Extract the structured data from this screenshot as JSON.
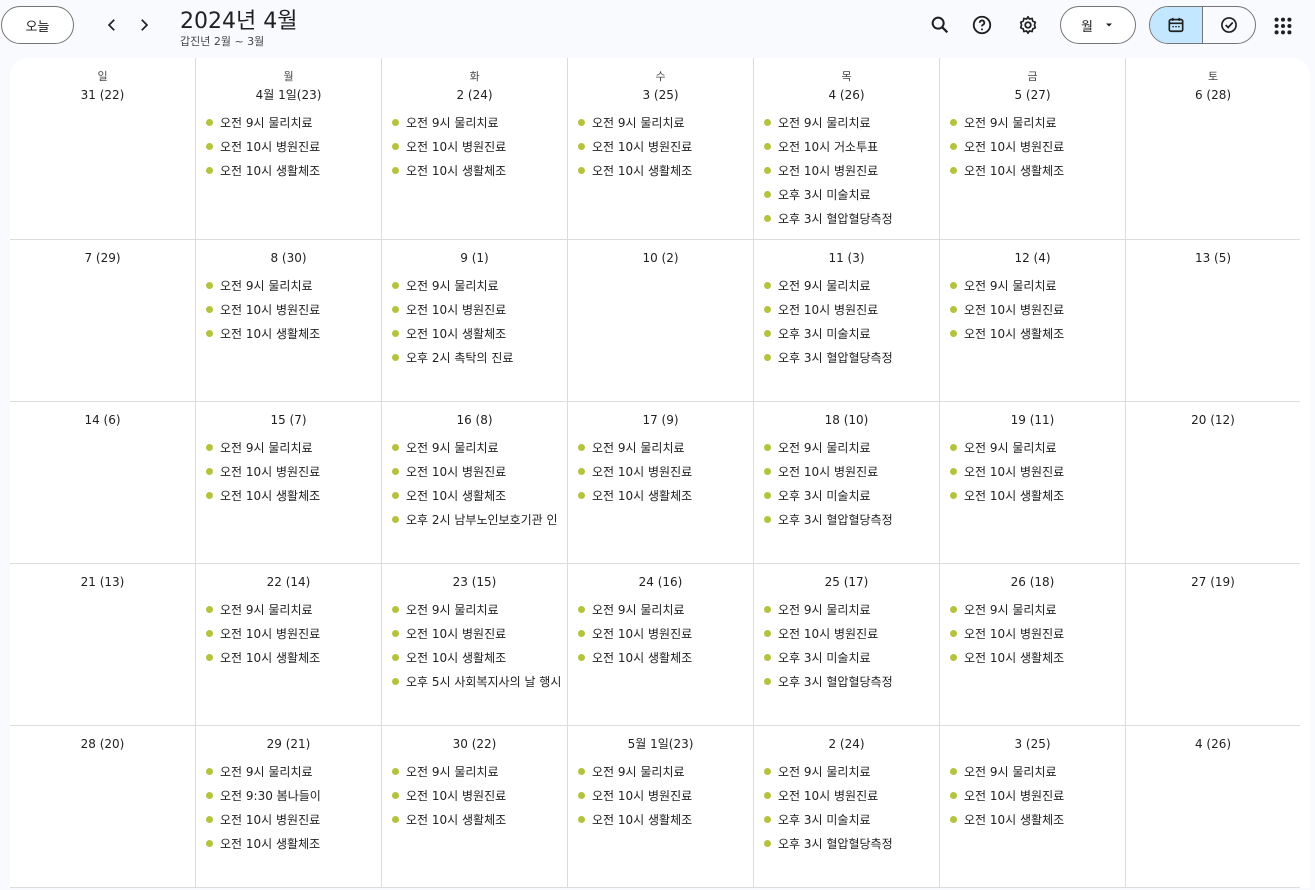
{
  "header": {
    "today_label": "오늘",
    "title": "2024년 4월",
    "subtitle": "갑진년 2월 ~ 3월",
    "view_label": "월",
    "icons": [
      "search-icon",
      "help-icon",
      "settings-icon",
      "calendar-icon",
      "tasks-icon",
      "apps-icon"
    ]
  },
  "colors": {
    "event_dot": "#b4c23c",
    "toggle_active": "#c2e7ff"
  },
  "weekdays": [
    "일",
    "월",
    "화",
    "수",
    "목",
    "금",
    "토"
  ],
  "weeks": [
    [
      {
        "label": "31 (22)",
        "events": []
      },
      {
        "label": "4월 1일(23)",
        "events": [
          "오전 9시 물리치료",
          "오전 10시 병원진료",
          "오전 10시 생활체조"
        ]
      },
      {
        "label": "2 (24)",
        "events": [
          "오전 9시 물리치료",
          "오전 10시 병원진료",
          "오전 10시 생활체조"
        ]
      },
      {
        "label": "3 (25)",
        "events": [
          "오전 9시 물리치료",
          "오전 10시 병원진료",
          "오전 10시 생활체조"
        ]
      },
      {
        "label": "4 (26)",
        "events": [
          "오전 9시 물리치료",
          "오전 10시 거소투표",
          "오전 10시 병원진료",
          "오후 3시 미술치료",
          "오후 3시 혈압혈당측정"
        ]
      },
      {
        "label": "5 (27)",
        "events": [
          "오전 9시 물리치료",
          "오전 10시 병원진료",
          "오전 10시 생활체조"
        ]
      },
      {
        "label": "6 (28)",
        "events": []
      }
    ],
    [
      {
        "label": "7 (29)",
        "events": []
      },
      {
        "label": "8 (30)",
        "events": [
          "오전 9시 물리치료",
          "오전 10시 병원진료",
          "오전 10시 생활체조"
        ]
      },
      {
        "label": "9 (1)",
        "events": [
          "오전 9시 물리치료",
          "오전 10시 병원진료",
          "오전 10시 생활체조",
          "오후 2시 촉탁의 진료"
        ]
      },
      {
        "label": "10 (2)",
        "events": []
      },
      {
        "label": "11 (3)",
        "events": [
          "오전 9시 물리치료",
          "오전 10시 병원진료",
          "오후 3시 미술치료",
          "오후 3시 혈압혈당측정"
        ]
      },
      {
        "label": "12 (4)",
        "events": [
          "오전 9시 물리치료",
          "오전 10시 병원진료",
          "오전 10시 생활체조"
        ]
      },
      {
        "label": "13 (5)",
        "events": []
      }
    ],
    [
      {
        "label": "14 (6)",
        "events": []
      },
      {
        "label": "15 (7)",
        "events": [
          "오전 9시 물리치료",
          "오전 10시 병원진료",
          "오전 10시 생활체조"
        ]
      },
      {
        "label": "16 (8)",
        "events": [
          "오전 9시 물리치료",
          "오전 10시 병원진료",
          "오전 10시 생활체조",
          "오후 2시 남부노인보호기관 인"
        ]
      },
      {
        "label": "17 (9)",
        "events": [
          "오전 9시 물리치료",
          "오전 10시 병원진료",
          "오전 10시 생활체조"
        ]
      },
      {
        "label": "18 (10)",
        "events": [
          "오전 9시 물리치료",
          "오전 10시 병원진료",
          "오후 3시 미술치료",
          "오후 3시 혈압혈당측정"
        ]
      },
      {
        "label": "19 (11)",
        "events": [
          "오전 9시 물리치료",
          "오전 10시 병원진료",
          "오전 10시 생활체조"
        ]
      },
      {
        "label": "20 (12)",
        "events": []
      }
    ],
    [
      {
        "label": "21 (13)",
        "events": []
      },
      {
        "label": "22 (14)",
        "events": [
          "오전 9시 물리치료",
          "오전 10시 병원진료",
          "오전 10시 생활체조"
        ]
      },
      {
        "label": "23 (15)",
        "events": [
          "오전 9시 물리치료",
          "오전 10시 병원진료",
          "오전 10시 생활체조",
          "오후 5시 사회복지사의 날 행시"
        ]
      },
      {
        "label": "24 (16)",
        "events": [
          "오전 9시 물리치료",
          "오전 10시 병원진료",
          "오전 10시 생활체조"
        ]
      },
      {
        "label": "25 (17)",
        "events": [
          "오전 9시 물리치료",
          "오전 10시 병원진료",
          "오후 3시 미술치료",
          "오후 3시 혈압혈당측정"
        ]
      },
      {
        "label": "26 (18)",
        "events": [
          "오전 9시 물리치료",
          "오전 10시 병원진료",
          "오전 10시 생활체조"
        ]
      },
      {
        "label": "27 (19)",
        "events": []
      }
    ],
    [
      {
        "label": "28 (20)",
        "events": []
      },
      {
        "label": "29 (21)",
        "events": [
          "오전 9시 물리치료",
          "오전 9:30 봄나들이",
          "오전 10시 병원진료",
          "오전 10시 생활체조"
        ]
      },
      {
        "label": "30 (22)",
        "events": [
          "오전 9시 물리치료",
          "오전 10시 병원진료",
          "오전 10시 생활체조"
        ]
      },
      {
        "label": "5월 1일(23)",
        "events": [
          "오전 9시 물리치료",
          "오전 10시 병원진료",
          "오전 10시 생활체조"
        ]
      },
      {
        "label": "2 (24)",
        "events": [
          "오전 9시 물리치료",
          "오전 10시 병원진료",
          "오후 3시 미술치료",
          "오후 3시 혈압혈당측정"
        ]
      },
      {
        "label": "3 (25)",
        "events": [
          "오전 9시 물리치료",
          "오전 10시 병원진료",
          "오전 10시 생활체조"
        ]
      },
      {
        "label": "4 (26)",
        "events": []
      }
    ]
  ]
}
